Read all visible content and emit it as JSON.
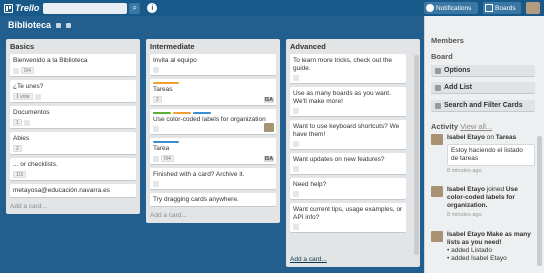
{
  "topbar": {
    "logo": "Trello",
    "search_placeholder": "",
    "notifications_label": "Notifications",
    "boards_label": "Boards"
  },
  "board": {
    "title": "Biblioteca"
  },
  "lists": [
    {
      "title": "Basics",
      "cards": [
        {
          "text": "Bienvenido a la Biblioteca",
          "badges": [
            "0/4"
          ]
        },
        {
          "text": "¿Te unes?",
          "badges": [
            "1 vote"
          ]
        },
        {
          "text": "Documentos",
          "badges": [
            "1"
          ]
        },
        {
          "text": "Abies",
          "badges": [
            "2"
          ]
        },
        {
          "text": "... or checklists.",
          "badges": [
            "1/3"
          ]
        },
        {
          "text": "metayosa@educación.navarra.es",
          "badges": []
        }
      ],
      "add_card": "Add a card..."
    },
    {
      "title": "Intermediate",
      "cards": [
        {
          "text": "Invita al equipo",
          "badges": []
        },
        {
          "text": "Tareas",
          "badges": [
            "2"
          ],
          "member": "ISA"
        },
        {
          "text": "Use color-coded labels for organization",
          "badges": []
        },
        {
          "text": "Tarea",
          "badges": [
            "0/4"
          ],
          "member": "ISA"
        },
        {
          "text": "Finished with a card? Archive it.",
          "badges": []
        },
        {
          "text": "Try dragging cards anywhere.",
          "badges": []
        }
      ],
      "add_card": "Add a card..."
    },
    {
      "title": "Advanced",
      "cards": [
        {
          "text": "To learn more tricks, check out the guide."
        },
        {
          "text": "Use as many boards as you want. We'll make more!"
        },
        {
          "text": "Want to use keyboard shortcuts? We have them!"
        },
        {
          "text": "Want updates on new features?"
        },
        {
          "text": "Need help?"
        },
        {
          "text": "Want current tips, usage examples, or API info?"
        }
      ],
      "add_card": "Add a card..."
    }
  ],
  "sidebar": {
    "members_heading": "Members",
    "board_heading": "Board",
    "options_label": "Options",
    "add_list_label": "Add List",
    "search_filter_label": "Search and Filter Cards",
    "activity_heading": "Activity",
    "view_all": "View all...",
    "activities": [
      {
        "actor": "Isabel Etayo",
        "action": "on",
        "target": "Tareas",
        "comment": "Estoy haciendo el listado de tareas",
        "time": "8 minutes ago"
      },
      {
        "actor": "Isabel Etayo",
        "action": "joined",
        "target": "Use color-coded labels for organization.",
        "time": "8 minutes ago"
      },
      {
        "actor": "Isabel Etayo",
        "action": "Make as many lists as you need!",
        "sub1": "added Listado",
        "sub2": "added Isabel Etayo"
      }
    ]
  },
  "colors": {
    "topbar": "#175988",
    "board_bg": "#225f8e",
    "list_bg": "#e2e4e6",
    "label_orange": "#f0a030",
    "label_blue": "#3b8ecf",
    "label_green": "#5ab030"
  }
}
